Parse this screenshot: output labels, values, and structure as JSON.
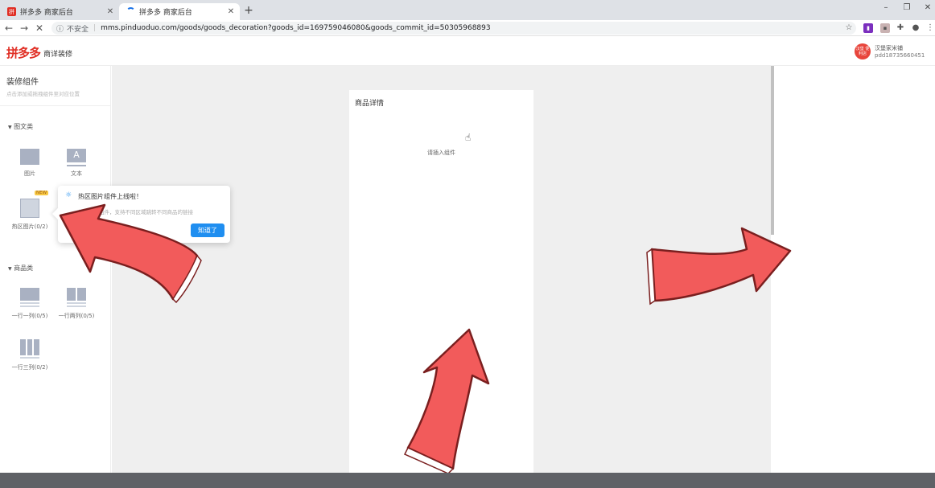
{
  "browser": {
    "tabs": [
      {
        "title": "拼多多 商家后台"
      },
      {
        "title": "拼多多 商家后台"
      }
    ],
    "url": "mms.pinduoduo.com/goods/goods_decoration?goods_id=169759046080&goods_commit_id=50305968893",
    "insecure_label": "不安全"
  },
  "header": {
    "logo": "拼多多",
    "subtitle": "商详装修",
    "avatar_text": "汉堡 便利店",
    "shop_name": "汉堡家米铺",
    "shop_id": "pdd18735660451"
  },
  "sidebar": {
    "title": "装修组件",
    "hint": "点击添加或拖拽组件至对应位置",
    "sections": [
      {
        "title": "图文类",
        "items": [
          {
            "label": "图片"
          },
          {
            "label": "文本"
          },
          {
            "label": "热区图片(0/2)",
            "badge": "NEW"
          }
        ]
      },
      {
        "title": "商品类",
        "items": [
          {
            "label": "一行一列(0/5)"
          },
          {
            "label": "一行两列(0/5)"
          },
          {
            "label": "一行三列(0/2)"
          }
        ]
      }
    ]
  },
  "popover": {
    "title": "热区图片组件上线啦！",
    "desc": "热区图片组件，支持不同区域跳转不同商品的链接",
    "button": "知道了"
  },
  "canvas": {
    "phone_title": "商品详情",
    "empty_hint": "请插入组件"
  },
  "colors": {
    "brand": "#e02e24",
    "accent": "#1f8ef0",
    "arrow_fill": "#f25b5b",
    "arrow_stroke": "#7a1f1f"
  }
}
